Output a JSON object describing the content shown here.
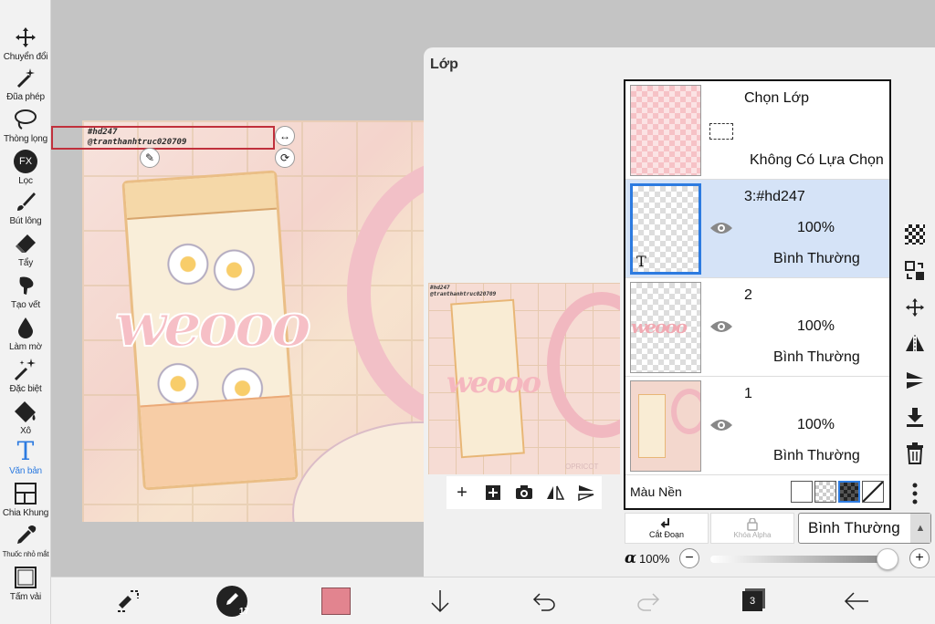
{
  "left_toolbar": {
    "tools": [
      {
        "label": "Chuyển đổi",
        "icon": "move-arrows-icon"
      },
      {
        "label": "Đũa phép",
        "icon": "magic-wand-icon"
      },
      {
        "label": "Thòng lọng",
        "icon": "lasso-icon"
      },
      {
        "label": "Lọc",
        "icon": "fx-filter-icon",
        "glyph": "FX"
      },
      {
        "label": "Bút lông",
        "icon": "brush-icon"
      },
      {
        "label": "Tẩy",
        "icon": "eraser-icon"
      },
      {
        "label": "Tạo vết",
        "icon": "smudge-icon"
      },
      {
        "label": "Làm mờ",
        "icon": "blur-drop-icon"
      },
      {
        "label": "Đặc biệt",
        "icon": "special-sparkle-icon"
      },
      {
        "label": "Xô",
        "icon": "bucket-icon"
      },
      {
        "label": "Văn bản",
        "icon": "text-t-icon",
        "glyph": "T"
      },
      {
        "label": "Chia Khung",
        "icon": "frame-divider-icon"
      },
      {
        "label": "Thuốc nhỏ mắt",
        "icon": "eyedropper-icon"
      },
      {
        "label": "Tấm vải",
        "icon": "canvas-icon"
      }
    ],
    "active_tool": "Văn bản"
  },
  "canvas": {
    "text_layer_lines": [
      "#hd247",
      "@tranthanhtruc020709"
    ],
    "watermark_preview": "OPRICOT"
  },
  "layer_panel": {
    "title": "Lớp",
    "selection_row": {
      "title": "Chọn Lớp",
      "status": "Không Có Lựa Chọn"
    },
    "layers": [
      {
        "name": "3:#hd247",
        "opacity": "100%",
        "blend": "Bình Thường",
        "selected": true,
        "thumb_glyph": "T"
      },
      {
        "name": "2",
        "opacity": "100%",
        "blend": "Bình Thường",
        "selected": false
      },
      {
        "name": "1",
        "opacity": "100%",
        "blend": "Bình Thường",
        "selected": false
      }
    ],
    "background_label": "Màu Nền",
    "clip_label": "Cắt Đoạn",
    "alpha_lock_label": "Khóa Alpha",
    "blend_mode": "Bình Thường",
    "opacity_symbol": "α",
    "opacity_value": "100%",
    "opacity_fraction": 1.0
  },
  "bottom_toolbar": {
    "brush_size": "17",
    "color": "#e2848f",
    "layer_count": "3"
  },
  "colors": {
    "accent": "#2d7be0",
    "selected_row": "#d5e3f7",
    "text_box_border": "#c0303c"
  }
}
